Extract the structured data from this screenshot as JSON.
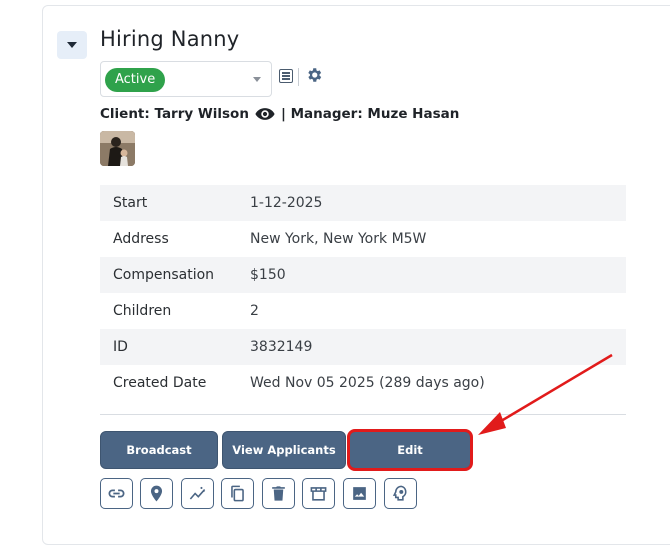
{
  "job": {
    "title": "Hiring Nanny",
    "status": "Active",
    "client_line": "Client: Tarry Wilson",
    "manager_line": "| Manager: Muze Hasan"
  },
  "details": [
    {
      "label": "Start",
      "value": "1-12-2025"
    },
    {
      "label": "Address",
      "value": "New York, New York M5W"
    },
    {
      "label": "Compensation",
      "value": "$150"
    },
    {
      "label": "Children",
      "value": "2"
    },
    {
      "label": "ID",
      "value": "3832149"
    },
    {
      "label": "Created Date",
      "value": "Wed Nov 05 2025 (289 days ago)"
    }
  ],
  "actions": {
    "broadcast": "Broadcast",
    "view_applicants": "View Applicants",
    "edit": "Edit"
  },
  "icon_buttons": [
    "link-icon",
    "location-pin-icon",
    "trend-icon",
    "copy-icon",
    "trash-icon",
    "store-icon",
    "image-icon",
    "lightbulb-head-icon"
  ],
  "colors": {
    "accent": "#4b6584",
    "status_active": "#2fa24b",
    "highlight": "#e11b1b"
  }
}
